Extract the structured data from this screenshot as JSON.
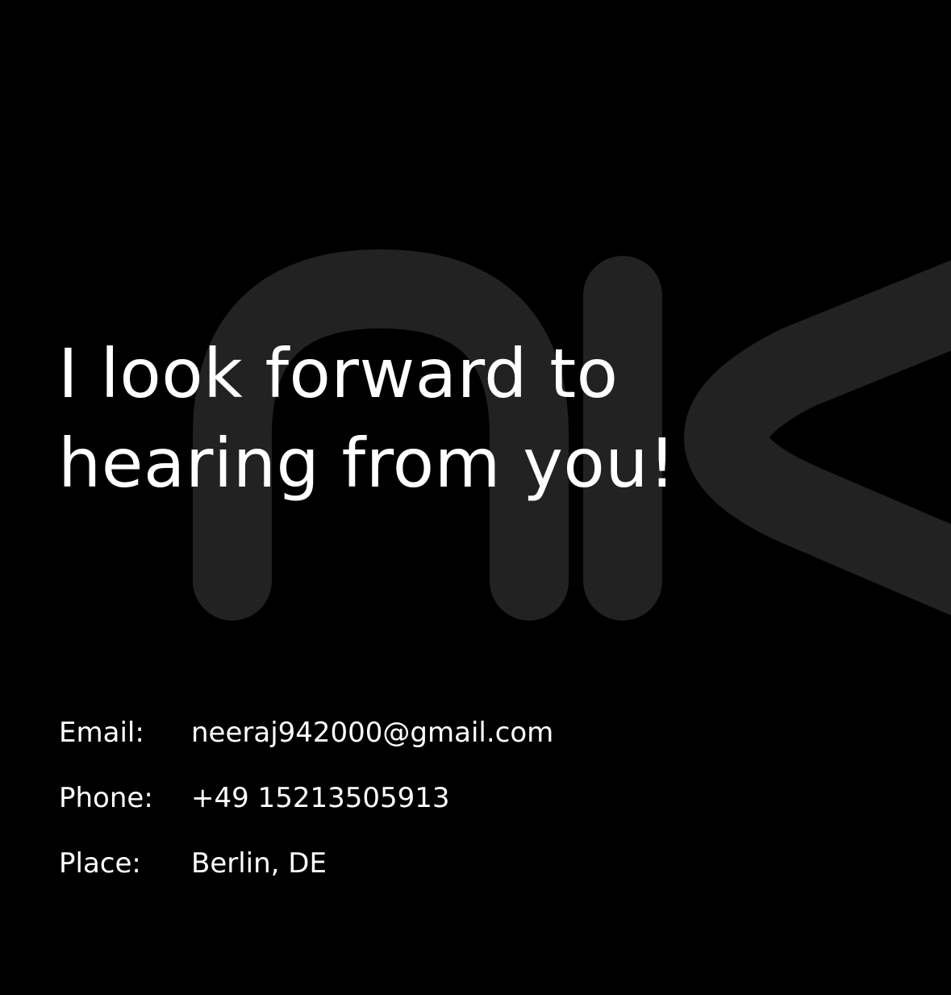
{
  "hero": {
    "line1": "I look forward to",
    "line2": "hearing from you!"
  },
  "contact": {
    "email_label": "Email:",
    "email_value": "neeraj942000@gmail.com",
    "phone_label": "Phone:",
    "phone_value": "+49 15213505913",
    "place_label": "Place:",
    "place_value": "Berlin, DE"
  },
  "colors": {
    "background": "#000000",
    "text": "#ffffff",
    "watermark": "#222222"
  },
  "icons": {
    "background_logo": "nk-monogram-watermark"
  }
}
